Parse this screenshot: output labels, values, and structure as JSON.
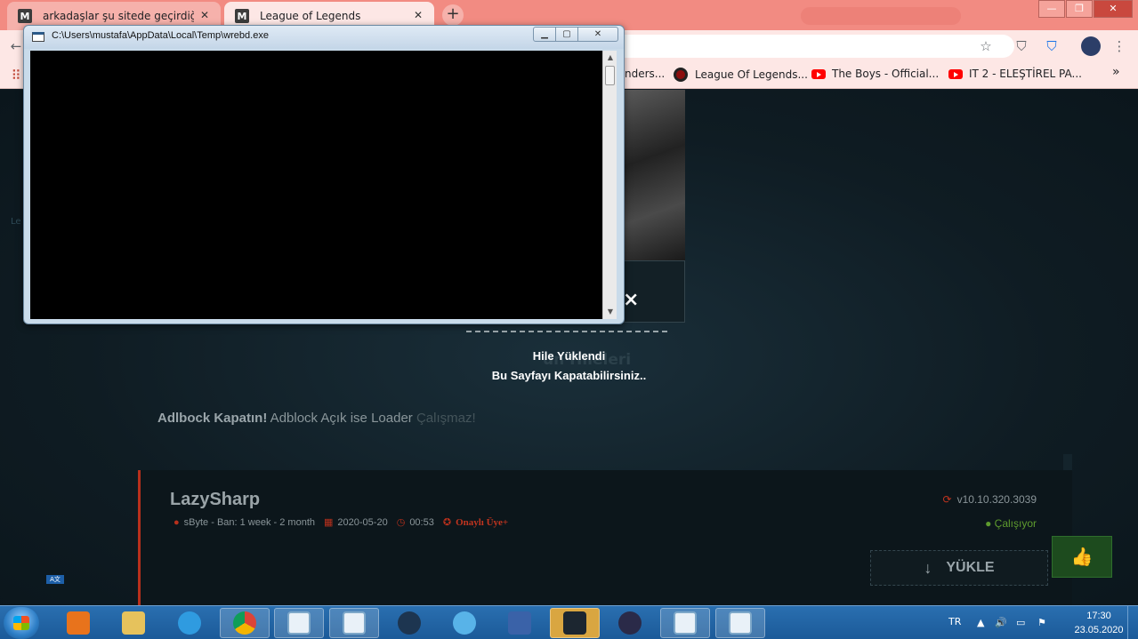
{
  "browser": {
    "tabs": [
      {
        "title": "arkadaşlar şu sitede geçirdiğim h",
        "favicon": "M"
      },
      {
        "title": "League of Legends",
        "favicon": "M"
      }
    ],
    "new_tab_label": "+",
    "bookmarks": [
      {
        "label": "nders...",
        "icon": "unknown-icon"
      },
      {
        "label": "League Of Legends...",
        "icon": "lol-icon"
      },
      {
        "label": "The Boys - Official...",
        "icon": "youtube-icon"
      },
      {
        "label": "IT 2 - ELEŞTİREL PA...",
        "icon": "youtube-icon"
      }
    ],
    "more_bookmarks": "»"
  },
  "console": {
    "title": "C:\\Users\\mustafa\\AppData\\Local\\Temp\\wrebd.exe"
  },
  "page": {
    "side_text": "Le",
    "close_glyph": "×",
    "background_title": "un Hileleri",
    "loaded_line1": "Hile Yüklendi",
    "loaded_line2": "Bu Sayfayı Kapatabilirsiniz..",
    "adblock_bold": "Adlbock Kapatın!",
    "adblock_text": " Adblock Açık ise Loader ",
    "adblock_faded": "Çalışmaz!",
    "cheat": {
      "name": "LazySharp",
      "author": "sByte - Ban: 1 week - 2 month",
      "date": "2020-05-20",
      "time": "00:53",
      "verified": "Onaylı Üye+",
      "version": "v10.10.320.3039",
      "status": "Çalışıyor",
      "download_label": "YÜKLE"
    }
  },
  "taskbar": {
    "language": "TR",
    "time": "17:30",
    "date": "23.05.2020"
  },
  "colors": {
    "tab_strip": "#f28b82",
    "accent_red": "#b8301c",
    "status_green": "#5e9b2e",
    "taskbar": "#1b5a99"
  }
}
